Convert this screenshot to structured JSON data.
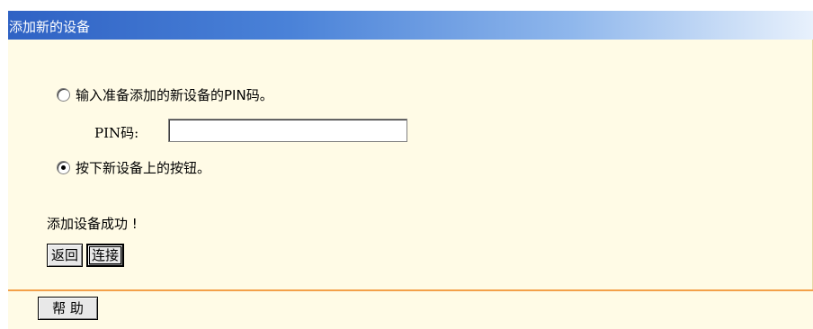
{
  "header": {
    "title": "添加新的设备"
  },
  "options": {
    "pin_option_label": "输入准备添加的新设备的PIN码。",
    "pin_field_label": "PIN码:",
    "pin_value": "",
    "button_option_label": "按下新设备上的按钮。",
    "selected": "button"
  },
  "status": {
    "message": "添加设备成功 !"
  },
  "buttons": {
    "back_label": "返回",
    "connect_label": "连接",
    "help_label": "帮 助"
  }
}
